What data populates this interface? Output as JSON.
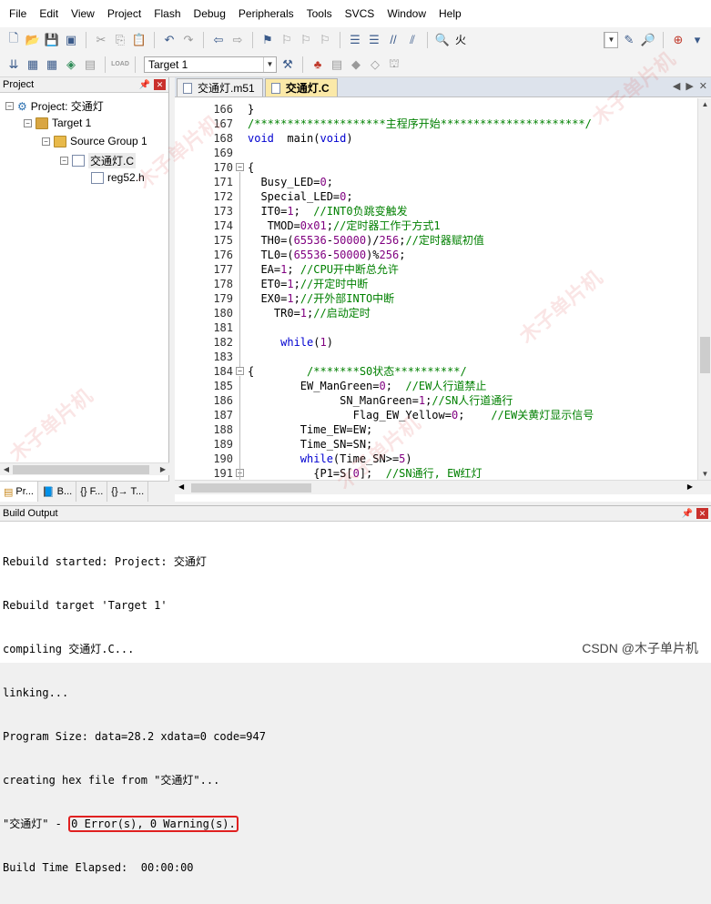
{
  "menu": [
    "File",
    "Edit",
    "View",
    "Project",
    "Flash",
    "Debug",
    "Peripherals",
    "Tools",
    "SVCS",
    "Window",
    "Help"
  ],
  "toolbar": {
    "target_value": "Target 1",
    "fire_label": "火",
    "lock_label": "LOAD"
  },
  "project_panel": {
    "title": "Project",
    "tree": {
      "root": "Project: 交通灯",
      "target": "Target 1",
      "group": "Source Group 1",
      "file_c": "交通灯.C",
      "file_h": "reg52.h"
    },
    "tabs": [
      "Pr...",
      "B...",
      "{} F...",
      "{}→ T..."
    ]
  },
  "editor": {
    "tabs": [
      "交通灯.m51",
      "交通灯.C"
    ],
    "lines": [
      {
        "n": "166",
        "t": "}"
      },
      {
        "n": "167",
        "t": "/********************主程序开始**********************/"
      },
      {
        "n": "168",
        "t": "void  main(void)"
      },
      {
        "n": "169",
        "t": ""
      },
      {
        "n": "170",
        "t": "{"
      },
      {
        "n": "171",
        "t": "  Busy_LED=0;"
      },
      {
        "n": "172",
        "t": "  Special_LED=0;"
      },
      {
        "n": "173",
        "t": "  IT0=1;  //INT0负跳变触发"
      },
      {
        "n": "174",
        "t": "   TMOD=0x01;//定时器工作于方式1"
      },
      {
        "n": "175",
        "t": "  TH0=(65536-50000)/256;//定时器赋初值"
      },
      {
        "n": "176",
        "t": "  TL0=(65536-50000)%256;"
      },
      {
        "n": "177",
        "t": "  EA=1; //CPU开中断总允许"
      },
      {
        "n": "178",
        "t": "  ET0=1;//开定时中断"
      },
      {
        "n": "179",
        "t": "  EX0=1;//开外部INTO中断"
      },
      {
        "n": "180",
        "t": "    TR0=1;//启动定时"
      },
      {
        "n": "181",
        "t": ""
      },
      {
        "n": "182",
        "t": "     while(1)"
      },
      {
        "n": "183",
        "t": ""
      },
      {
        "n": "184",
        "t": "{        /*******S0状态**********/"
      },
      {
        "n": "185",
        "t": "        EW_ManGreen=0;  //EW人行道禁止"
      },
      {
        "n": "186",
        "t": "              SN_ManGreen=1;//SN人行道通行"
      },
      {
        "n": "187",
        "t": "                Flag_EW_Yellow=0;    //EW关黄灯显示信号"
      },
      {
        "n": "188",
        "t": "        Time_EW=EW;"
      },
      {
        "n": "189",
        "t": "        Time_SN=SN;"
      },
      {
        "n": "190",
        "t": "        while(Time_SN>=5)"
      },
      {
        "n": "191",
        "t": "          {P1=S[0];  //SN通行, EW红灯"
      }
    ]
  },
  "build_output": {
    "title": "Build Output",
    "lines": [
      "Rebuild started: Project: 交通灯",
      "Rebuild target 'Target 1'",
      "compiling 交通灯.C...",
      "linking...",
      "Program Size: data=28.2 xdata=0 code=947",
      "creating hex file from \"交通灯\"..."
    ],
    "result_prefix": "\"交通灯\" - ",
    "result_highlight": "0 Error(s), 0 Warning(s)",
    "result_suffix": ".",
    "elapsed": "Build Time Elapsed:  00:00:00"
  },
  "footer_text": "CSDN @木子单片机",
  "watermark": "木子单片机"
}
